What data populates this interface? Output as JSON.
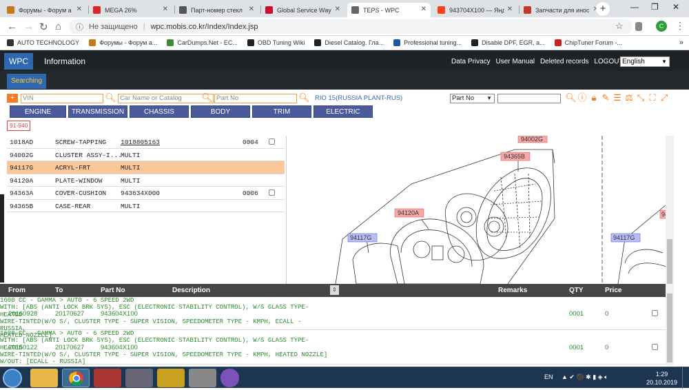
{
  "browser": {
    "tabs": [
      {
        "title": "Форумы - Форум а",
        "fav_color": "#c47a1a"
      },
      {
        "title": "MEGA 26%",
        "fav_color": "#d9272e"
      },
      {
        "title": "Парт-номер стекл",
        "fav_color": "#555555"
      },
      {
        "title": "Global Service Way",
        "fav_color": "#c8102e"
      },
      {
        "title": "TEPS - WPC",
        "fav_color": "#666666"
      },
      {
        "title": "943704X100 — Янд",
        "fav_color": "#fc3f1d"
      },
      {
        "title": "Запчасти для инос",
        "fav_color": "#c0392b"
      }
    ],
    "active_tab_index": 4,
    "address": {
      "security": "Не защищено",
      "url": "wpc.mobis.co.kr/Index/Index.jsp"
    },
    "avatar_letter": "C",
    "bookmarks": [
      {
        "label": "AUTO TECHNOLOGY",
        "color": "#333333"
      },
      {
        "label": "Форумы - Форум а...",
        "color": "#c47a1a"
      },
      {
        "label": "CarDumps.Net - EC...",
        "color": "#3a8a3a"
      },
      {
        "label": "OBD Tuning Wiki",
        "color": "#222222"
      },
      {
        "label": "Diesel Catalog. Гла...",
        "color": "#222222"
      },
      {
        "label": "Professional tuning...",
        "color": "#2255aa"
      },
      {
        "label": "Disable DPF, EGR, a...",
        "color": "#222222"
      },
      {
        "label": "ChipTuner Forum -...",
        "color": "#cc2222"
      }
    ],
    "bookmarks_more": "»"
  },
  "app": {
    "brand": "WPC",
    "nav_info": "Information",
    "header_links": [
      "Data Privacy",
      "User Manual",
      "Deleted records",
      "LOGOUT"
    ],
    "language": "English",
    "sub_tab": "Searching",
    "search": {
      "vin_placeholder": "VIN",
      "car_placeholder": "Car Name or Catalog",
      "part_placeholder": "Part No",
      "vehicle": "RIO 15(RUSSIA PLANT-RUS)",
      "search_type": "Part No"
    },
    "categories": [
      "ENGINE",
      "TRANSMISSION",
      "CHASSIS",
      "BODY",
      "TRIM",
      "ELECTRIC"
    ],
    "group_code": "91-940",
    "parts": [
      {
        "code": "1018AD",
        "name": "SCREW-TAPPING",
        "partno": "1018805163",
        "qty": "0004",
        "has_check": true,
        "link": true,
        "highlight": false
      },
      {
        "code": "94002G",
        "name": "CLUSTER ASSY-I...",
        "partno": "MULTI",
        "qty": "",
        "has_check": false,
        "link": false,
        "highlight": false
      },
      {
        "code": "94117G",
        "name": "ACRYL-FRT",
        "partno": "MULTI",
        "qty": "",
        "has_check": false,
        "link": false,
        "highlight": true
      },
      {
        "code": "94120A",
        "name": "PLATE-WINDOW",
        "partno": "MULTI",
        "qty": "",
        "has_check": false,
        "link": false,
        "highlight": false
      },
      {
        "code": "94363A",
        "name": "COVER-CUSHION",
        "partno": "943634X000",
        "qty": "0006",
        "has_check": true,
        "link": false,
        "highlight": false
      },
      {
        "code": "94365B",
        "name": "CASE-REAR",
        "partno": "MULTI",
        "qty": "",
        "has_check": false,
        "link": false,
        "highlight": false
      }
    ],
    "diagram_labels": {
      "l1": "94002G",
      "l2": "94365B",
      "l3": "94120A",
      "l4": "94117G",
      "l5": "94117G",
      "l6": "94"
    },
    "details": {
      "headers": {
        "from": "From",
        "to": "To",
        "partno": "Part No",
        "description": "Description",
        "remarks": "Remarks",
        "qty": "QTY",
        "price": "Price"
      },
      "sort_icon": "⇕",
      "rows": [
        {
          "from": "20160928",
          "to": "20170627",
          "partno": "943604X100",
          "desc": [
            "1600 CC - GAMMA > AUTO - 6 SPEED 2WD",
            "WITH: [ABS (ANTI LOCK BRK SYS), ESC (ELECTRONIC STABILITY CONTROL), W/S GLASS TYPE-HEATED",
            "WIRE-TINTED(W/O S/, CLUSTER TYPE - SUPER VISION, SPEEDOMETER TYPE - KMPH, ECALL - RUSSIA,",
            "HEATED NOZZLE]"
          ],
          "qty": "0001",
          "price": "0"
        },
        {
          "from": "20150122",
          "to": "20170627",
          "partno": "943604X100",
          "desc": [
            "1600 CC - GAMMA > AUTO - 6 SPEED 2WD",
            "WITH: [ABS (ANTI LOCK BRK SYS), ESC (ELECTRONIC STABILITY CONTROL), W/S GLASS TYPE-HEATED",
            "WIRE-TINTED(W/O S/, CLUSTER TYPE - SUPER VISION, SPEEDOMETER TYPE - KMPH, HEATED NOZZLE]",
            "W/OUT: [ECALL - RUSSIA]"
          ],
          "qty": "0001",
          "price": "0"
        }
      ]
    }
  },
  "taskbar": {
    "lang": "EN",
    "time": "1:29",
    "date": "20.10.2019"
  }
}
